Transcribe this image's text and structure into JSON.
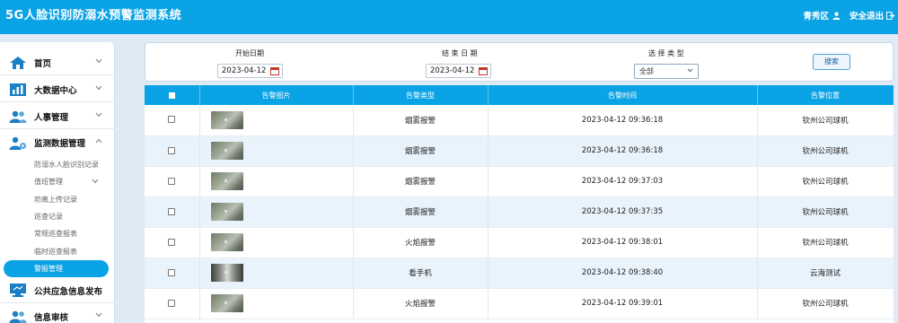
{
  "header": {
    "title": "5G人脸识别防溺水预警监测系统",
    "user": "青秀区",
    "logout": "安全退出"
  },
  "sidebar": {
    "items": [
      {
        "label": "首页",
        "icon": "home-icon"
      },
      {
        "label": "大数据中心",
        "icon": "bar-chart-icon"
      },
      {
        "label": "人事管理",
        "icon": "users-icon"
      },
      {
        "label": "监测数据管理",
        "icon": "user-gear-icon"
      },
      {
        "label": "公共应急信息发布",
        "icon": "monitor-icon"
      },
      {
        "label": "信息审核",
        "icon": "users-icon"
      }
    ],
    "sub_items": [
      {
        "label": "防溺水人脸识别记录"
      },
      {
        "label": "值班管理"
      },
      {
        "label": "劝离上传记录"
      },
      {
        "label": "巡查记录"
      },
      {
        "label": "常规巡查报表"
      },
      {
        "label": "临时巡查报表"
      },
      {
        "label": "警报管理"
      }
    ]
  },
  "search": {
    "start_label": "开始日期",
    "start_value": "2023-04-12",
    "end_label": "结 束 日 期",
    "end_value": "2023-04-12",
    "type_label": "选 择 类 型",
    "type_value": "全部",
    "button": "搜索"
  },
  "table": {
    "columns": [
      "告警图片",
      "告警类型",
      "告警时间",
      "告警位置"
    ],
    "rows": [
      {
        "type": "烟雾报警",
        "time": "2023-04-12 09:36:18",
        "location": "钦州公司球机"
      },
      {
        "type": "烟雾报警",
        "time": "2023-04-12 09:36:18",
        "location": "钦州公司球机"
      },
      {
        "type": "烟雾报警",
        "time": "2023-04-12 09:37:03",
        "location": "钦州公司球机"
      },
      {
        "type": "烟雾报警",
        "time": "2023-04-12 09:37:35",
        "location": "钦州公司球机"
      },
      {
        "type": "火焰报警",
        "time": "2023-04-12 09:38:01",
        "location": "钦州公司球机"
      },
      {
        "type": "看手机",
        "time": "2023-04-12 09:38:40",
        "location": "云海测试"
      },
      {
        "type": "火焰报警",
        "time": "2023-04-12 09:39:01",
        "location": "钦州公司球机"
      }
    ]
  },
  "colors": {
    "primary": "#0aa3e6",
    "row_alt": "#e9f3fb",
    "background": "#dfeaf4"
  }
}
